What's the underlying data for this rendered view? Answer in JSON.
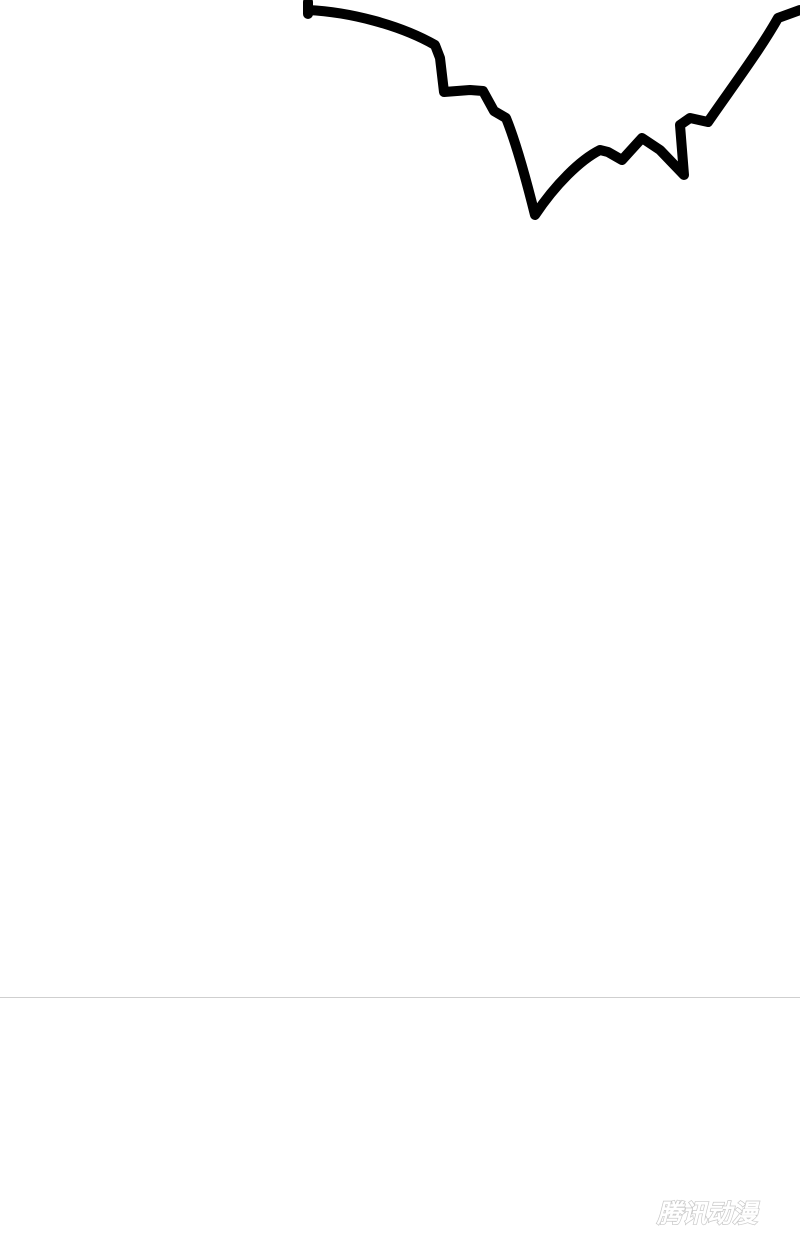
{
  "comic_page": {
    "watermark_text": "腾讯动漫",
    "background_color": "#ffffff",
    "ink_color": "#000000",
    "divider_color": "#cfcfcf",
    "watermark_color": "#c8c8c8"
  }
}
